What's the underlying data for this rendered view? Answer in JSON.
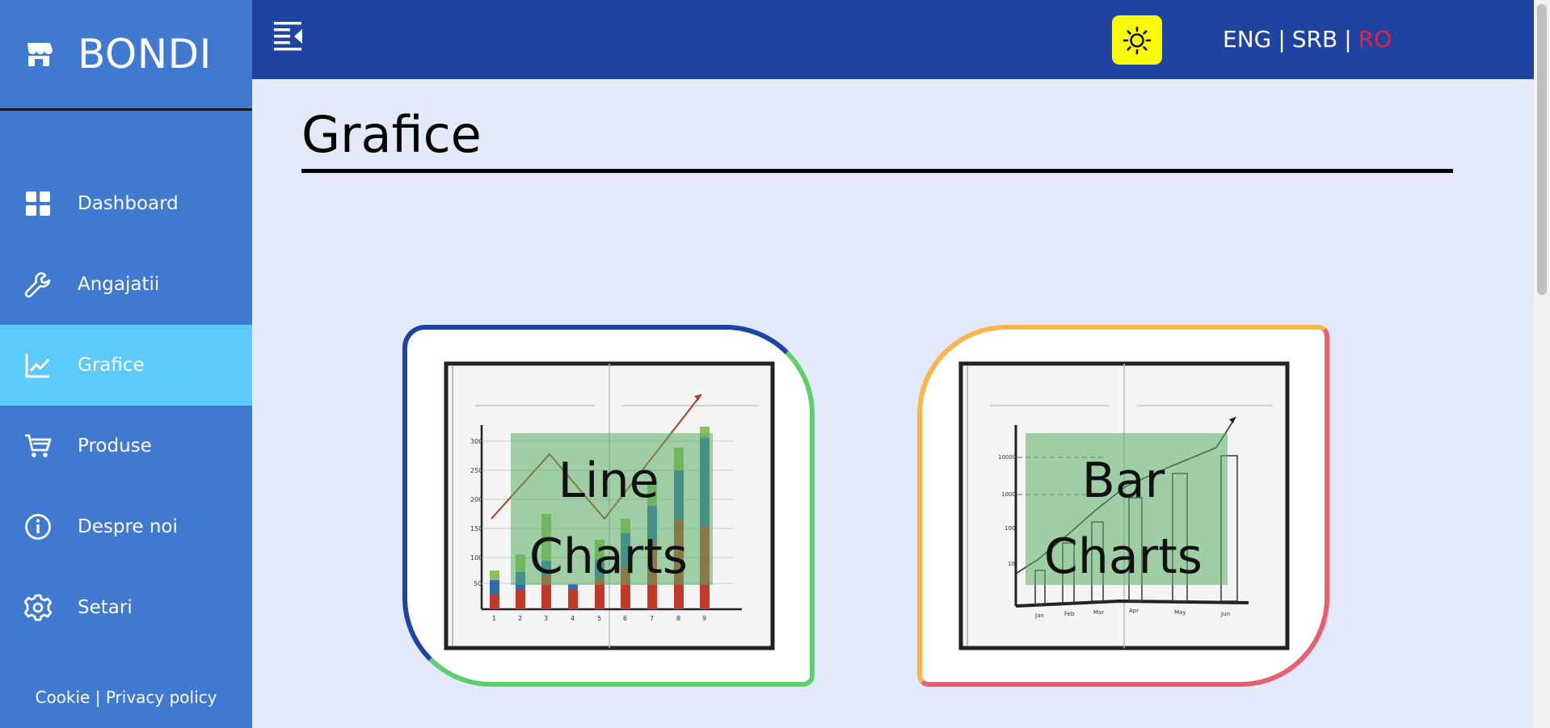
{
  "brand": {
    "title": "BONDI"
  },
  "sidebar": {
    "items": [
      {
        "label": "Dashboard",
        "icon": "dashboard-icon"
      },
      {
        "label": "Angajatii",
        "icon": "wrench-icon"
      },
      {
        "label": "Grafice",
        "icon": "line-chart-icon",
        "active": true
      },
      {
        "label": "Produse",
        "icon": "cart-icon"
      },
      {
        "label": "Despre noi",
        "icon": "info-icon"
      },
      {
        "label": "Setari",
        "icon": "gear-icon"
      }
    ],
    "footer": {
      "cookie": "Cookie",
      "separator": "|",
      "privacy": "Privacy policy"
    }
  },
  "topbar": {
    "languages": [
      "ENG",
      "SRB",
      "RO"
    ],
    "active_language": "RO",
    "separator": "|"
  },
  "page": {
    "title": "Grafice"
  },
  "cards": [
    {
      "line1": "Line",
      "line2": "Charts"
    },
    {
      "line1": "Bar",
      "line2": "Charts"
    }
  ],
  "colors": {
    "sidebar": "#3f7ad0",
    "active_item": "#5ccbfb",
    "topbar": "#1f43a1",
    "theme_button": "#f9f90a",
    "active_language": "#e5243e",
    "background": "#e3e9f8"
  }
}
